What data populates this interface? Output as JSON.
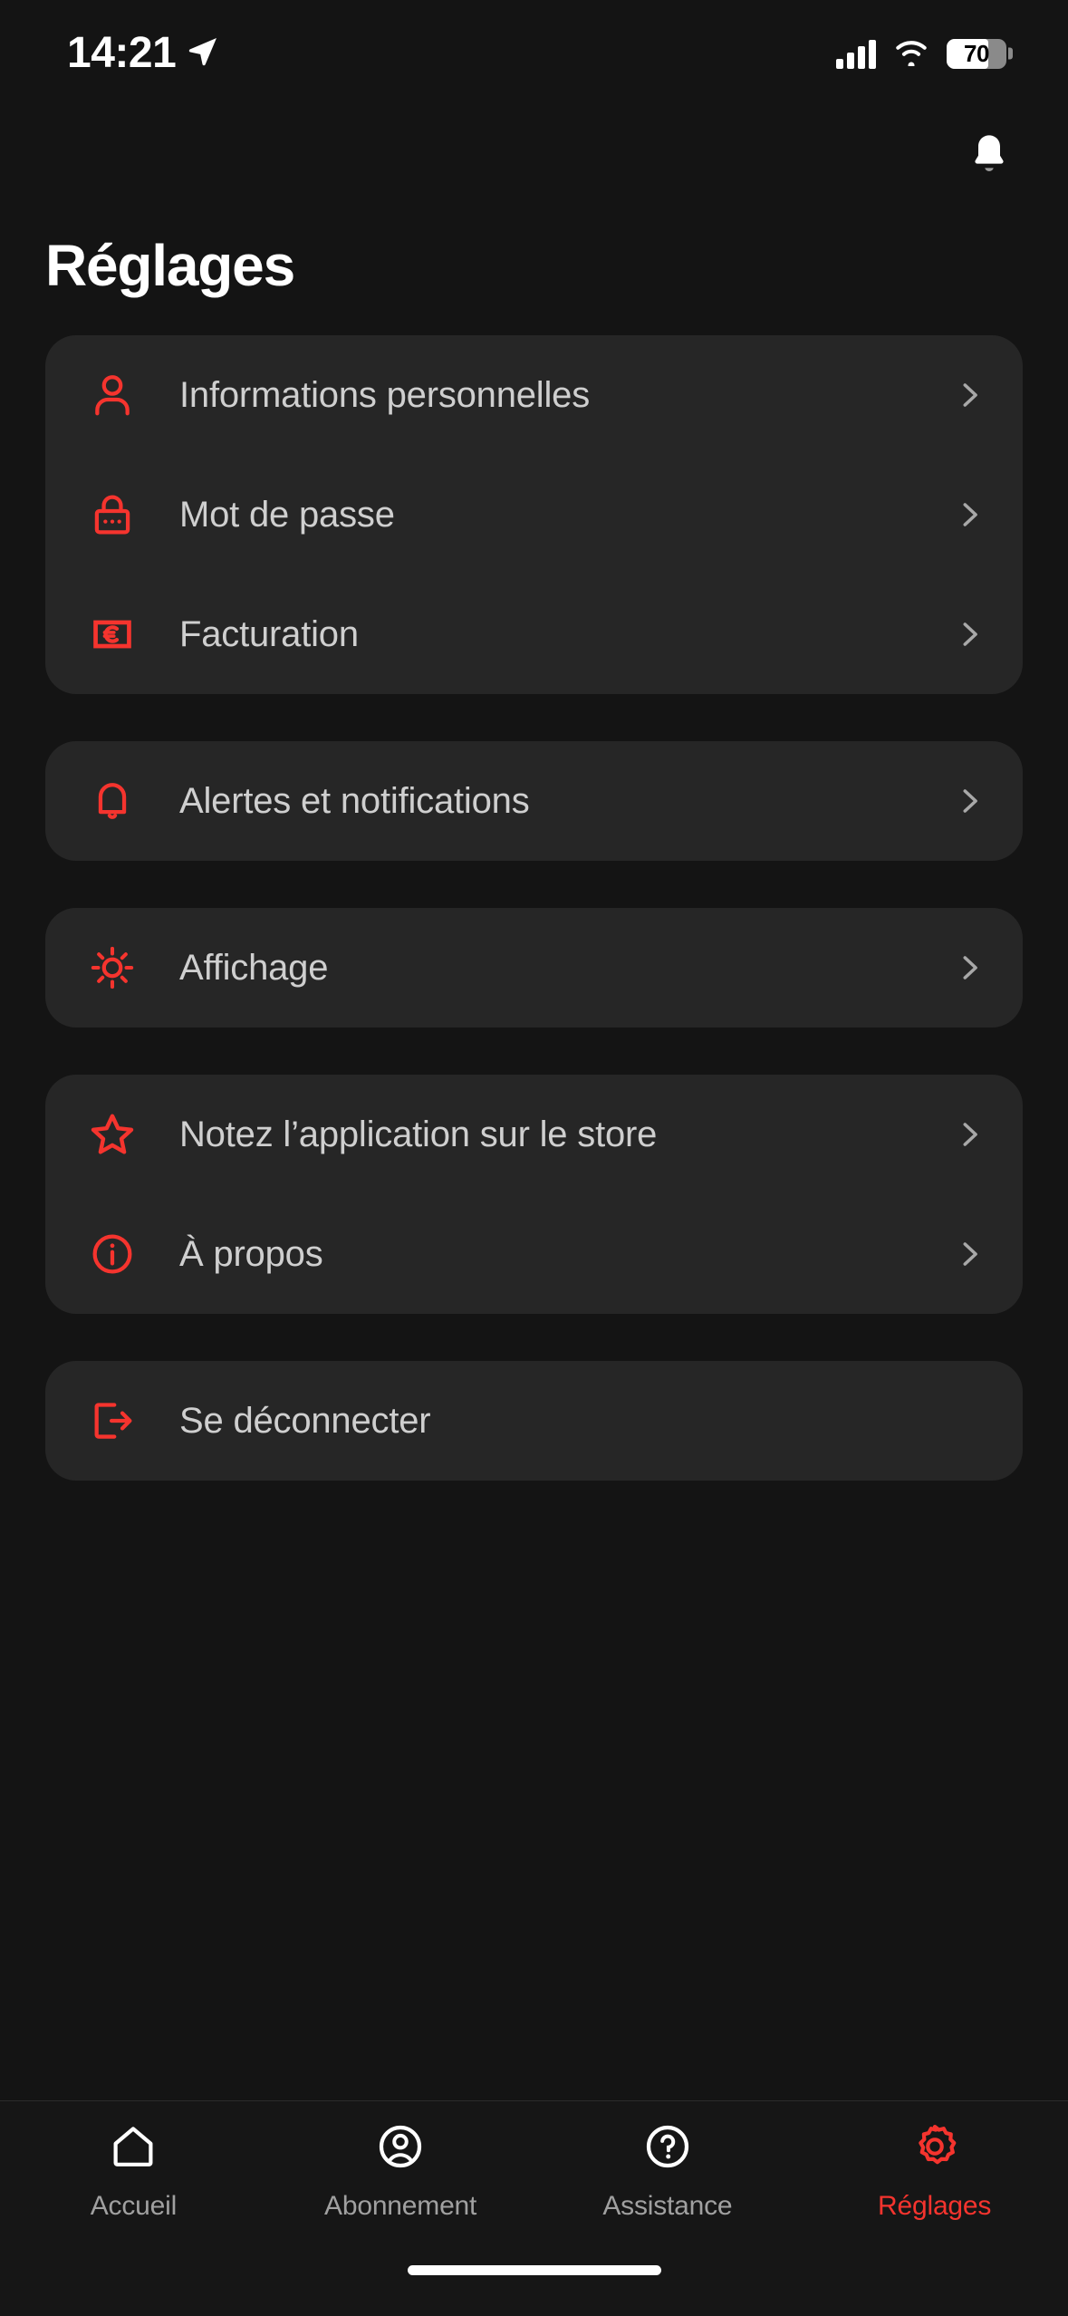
{
  "status_bar": {
    "time": "14:21",
    "location_icon": "location-arrow-icon",
    "signal_icon": "cellular-signal-icon",
    "wifi_icon": "wifi-icon",
    "battery_percent": "70",
    "battery_level": 70
  },
  "header": {
    "notification_icon": "bell-icon",
    "title": "Réglages"
  },
  "accent_color": "#f5342e",
  "card_color": "#262626",
  "background_color": "#141414",
  "label_color": "#cfcfcf",
  "groups": [
    {
      "items": [
        {
          "icon": "person-icon",
          "label": "Informations personnelles",
          "chevron": true
        },
        {
          "icon": "lock-icon",
          "label": "Mot de passe",
          "chevron": true
        },
        {
          "icon": "euro-card-icon",
          "label": "Facturation",
          "chevron": true
        }
      ]
    },
    {
      "items": [
        {
          "icon": "bell-icon",
          "label": "Alertes et notifications",
          "chevron": true
        }
      ]
    },
    {
      "items": [
        {
          "icon": "sun-icon",
          "label": "Affichage",
          "chevron": true
        }
      ]
    },
    {
      "items": [
        {
          "icon": "star-icon",
          "label": "Notez l’application sur le store",
          "chevron": true
        },
        {
          "icon": "info-circle-icon",
          "label": "À propos",
          "chevron": true
        }
      ]
    },
    {
      "items": [
        {
          "icon": "logout-icon",
          "label": "Se déconnecter",
          "chevron": false
        }
      ]
    }
  ],
  "tabbar": {
    "tabs": [
      {
        "icon": "home-icon",
        "label": "Accueil",
        "active": false
      },
      {
        "icon": "user-circle-icon",
        "label": "Abonnement",
        "active": false
      },
      {
        "icon": "question-circle-icon",
        "label": "Assistance",
        "active": false
      },
      {
        "icon": "gear-icon",
        "label": "Réglages",
        "active": true
      }
    ]
  }
}
